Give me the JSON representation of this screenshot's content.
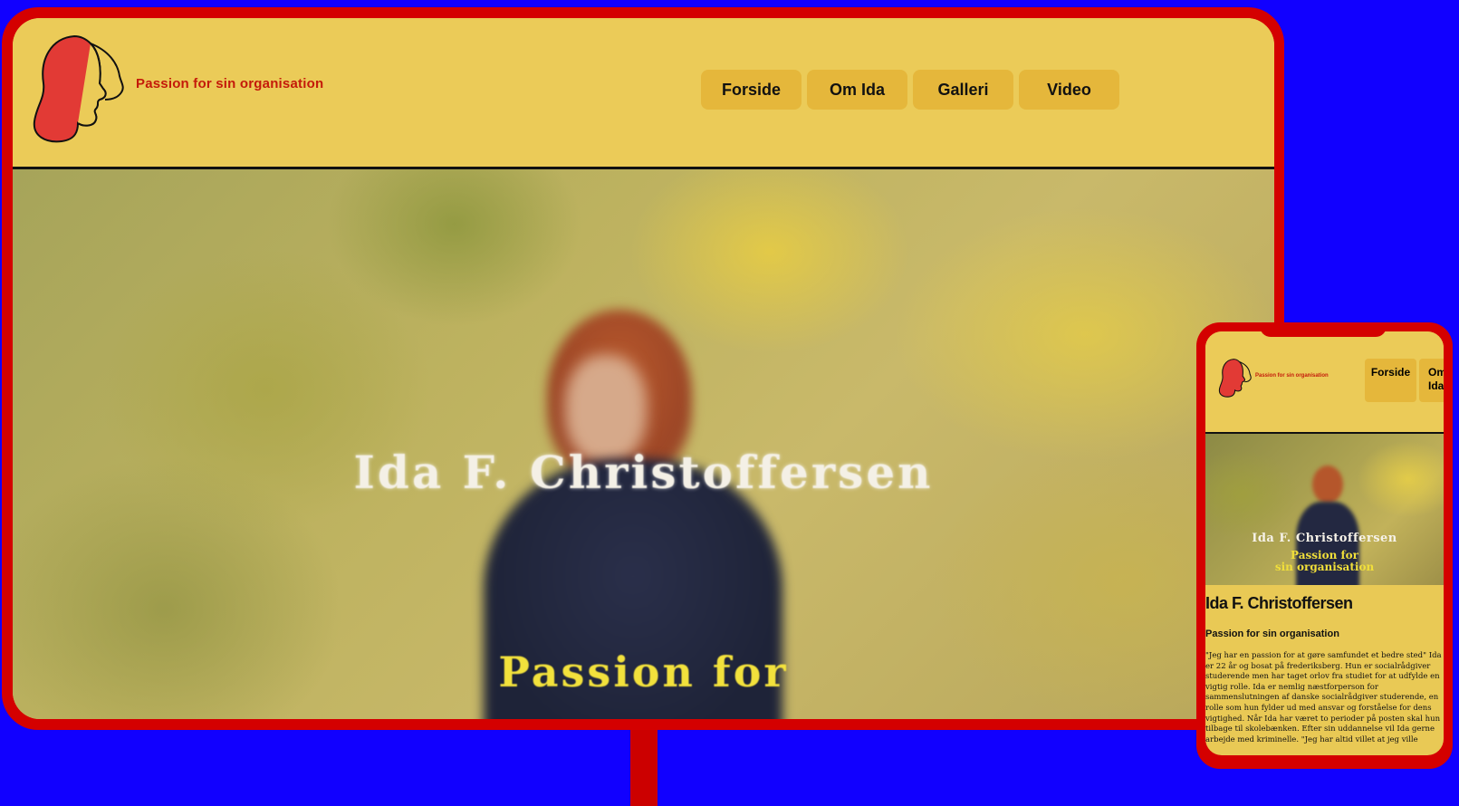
{
  "site": {
    "tagline": "Passion for sin organisation",
    "nav": [
      "Forside",
      "Om Ida",
      "Galleri",
      "Video"
    ]
  },
  "hero": {
    "name": "Ida F. Christoffersen",
    "subtitle_desktop": "Passion for",
    "subtitle_mobile_line1": "Passion for",
    "subtitle_mobile_line2": "sin organisation"
  },
  "mobile": {
    "nav_first": "Forside",
    "nav_second": "Om Ida",
    "title": "Ida F. Christoffersen",
    "subtitle": "Passion for sin organisation",
    "body": "\"Jeg har en passion for at gøre samfundet et bedre sted\" Ida er 22 år og bosat på frederiksberg. Hun er socialrådgiver studerende men har taget orlov fra studiet for at udfylde en vigtig rolle. Ida er nemlig næstforperson for sammenslutningen af danske socialrådgiver studerende, en rolle som hun fylder ud med ansvar og forståelse for dens vigtighed. Når Ida har været to perioder på posten skal hun tilbage til skolebænken. Efter sin uddannelse vil Ida gerne arbejde med kriminelle. \"Jeg har altid villet at jeg ville"
  },
  "colors": {
    "background": "#1100ff",
    "frame": "#d40000",
    "header": "#ebcb58",
    "nav_button": "#e5b73b",
    "tagline": "#c41a0a"
  }
}
